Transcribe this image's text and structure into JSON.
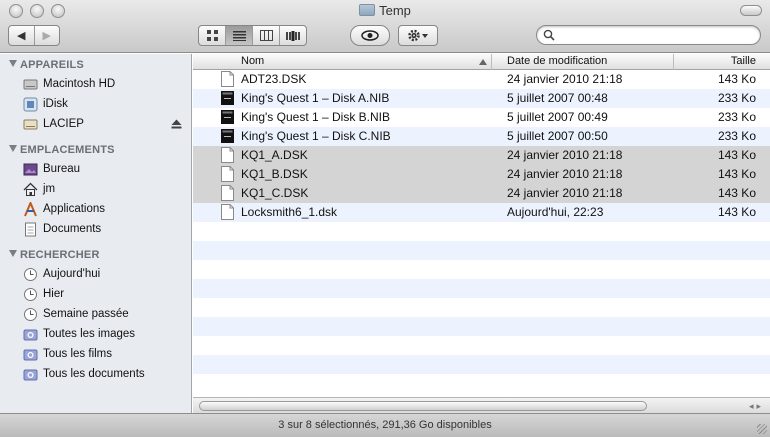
{
  "window": {
    "title": "Temp"
  },
  "toolbar": {
    "back_label": "◀",
    "forward_label": "▶",
    "view_modes": [
      "icons",
      "list",
      "columns",
      "coverflow"
    ],
    "search": {
      "value": "",
      "placeholder": ""
    }
  },
  "sidebar": {
    "sections": [
      {
        "title": "APPAREILS",
        "items": [
          {
            "label": "Macintosh HD",
            "icon": "hard-disk-icon"
          },
          {
            "label": "iDisk",
            "icon": "idisk-icon"
          },
          {
            "label": "LACIEP",
            "icon": "external-disk-icon"
          }
        ]
      },
      {
        "title": "EMPLACEMENTS",
        "items": [
          {
            "label": "Bureau",
            "icon": "desktop-icon"
          },
          {
            "label": "jm",
            "icon": "home-icon"
          },
          {
            "label": "Applications",
            "icon": "applications-icon"
          },
          {
            "label": "Documents",
            "icon": "documents-icon"
          }
        ]
      },
      {
        "title": "RECHERCHER",
        "items": [
          {
            "label": "Aujourd'hui",
            "icon": "clock-icon"
          },
          {
            "label": "Hier",
            "icon": "clock-icon"
          },
          {
            "label": "Semaine passée",
            "icon": "clock-icon"
          },
          {
            "label": "Toutes les images",
            "icon": "smart-folder-icon"
          },
          {
            "label": "Tous les films",
            "icon": "smart-folder-icon"
          },
          {
            "label": "Tous les documents",
            "icon": "smart-folder-icon"
          }
        ]
      }
    ]
  },
  "list": {
    "columns": {
      "name": "Nom",
      "date": "Date de modification",
      "size": "Taille"
    },
    "rows": [
      {
        "name": "ADT23.DSK",
        "date": "24 janvier 2010 21:18",
        "size": "143 Ko",
        "icon": "document-icon",
        "selected": false
      },
      {
        "name": "King's Quest 1 – Disk A.NIB",
        "date": "5 juillet 2007 00:48",
        "size": "233 Ko",
        "icon": "exec-icon",
        "selected": false
      },
      {
        "name": "King's Quest 1 – Disk B.NIB",
        "date": "5 juillet 2007 00:49",
        "size": "233 Ko",
        "icon": "exec-icon",
        "selected": false
      },
      {
        "name": "King's Quest 1 – Disk C.NIB",
        "date": "5 juillet 2007 00:50",
        "size": "233 Ko",
        "icon": "exec-icon",
        "selected": false
      },
      {
        "name": "KQ1_A.DSK",
        "date": "24 janvier 2010 21:18",
        "size": "143 Ko",
        "icon": "document-icon",
        "selected": true
      },
      {
        "name": "KQ1_B.DSK",
        "date": "24 janvier 2010 21:18",
        "size": "143 Ko",
        "icon": "document-icon",
        "selected": true
      },
      {
        "name": "KQ1_C.DSK",
        "date": "24 janvier 2010 21:18",
        "size": "143 Ko",
        "icon": "document-icon",
        "selected": true
      },
      {
        "name": "Locksmith6_1.dsk",
        "date": "Aujourd'hui, 22:23",
        "size": "143 Ko",
        "icon": "document-icon",
        "selected": false
      }
    ]
  },
  "status": {
    "text": "3 sur 8 sélectionnés, 291,36 Go disponibles"
  },
  "colors": {
    "stripe": "#edf3fe",
    "selected": "#d4d4d4",
    "sidebar": "#e8ecf1"
  }
}
